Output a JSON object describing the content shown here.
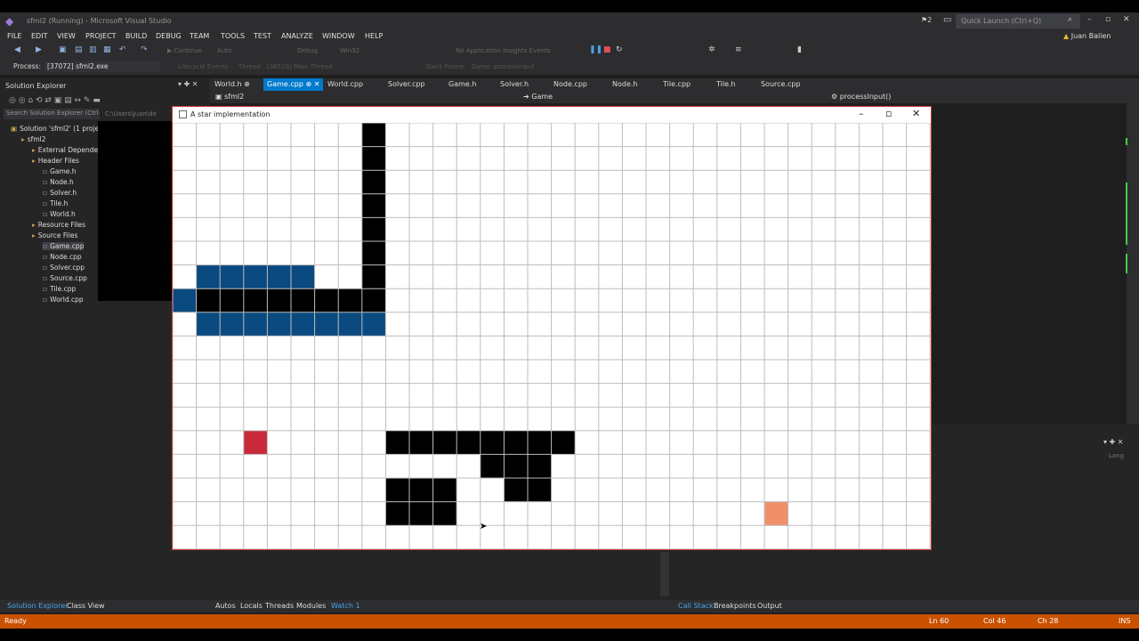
{
  "ide": {
    "title": "sfml2 (Running) - Microsoft Visual Studio",
    "notifications": "2",
    "quick_launch": "Quick Launch (Ctrl+Q)",
    "user": "Juan Balien",
    "menu": [
      "FILE",
      "EDIT",
      "VIEW",
      "PROJECT",
      "BUILD",
      "DEBUG",
      "TEAM",
      "TOOLS",
      "TEST",
      "ANALYZE",
      "WINDOW",
      "HELP"
    ],
    "toolbar": {
      "continue": "Continue",
      "auto": "Auto",
      "debug": "Debug",
      "platform": "Win32",
      "insights": "No Application Insights Events"
    },
    "debugbar": {
      "process_label": "Process:",
      "process_value": "[37072] sfml2.exe",
      "lifecycle": "Lifecycle Events",
      "thread_label": "Thread:",
      "thread_value": "[36520] Main Thread",
      "stack_label": "Stack Frame:",
      "stack_value": "Game::processInput"
    },
    "solution_explorer": {
      "title": "Solution Explorer",
      "search_placeholder": "Search Solution Explorer (Ctrl+;)",
      "path_hint": "C:\\Users\\Juan\\de",
      "tree": [
        {
          "label": "Solution 'sfml2' (1 proje",
          "indent": 0
        },
        {
          "label": "sfml2",
          "indent": 1
        },
        {
          "label": "External Dependencies",
          "indent": 2
        },
        {
          "label": "Header Files",
          "indent": 2
        },
        {
          "label": "Game.h",
          "indent": 3
        },
        {
          "label": "Node.h",
          "indent": 3
        },
        {
          "label": "Solver.h",
          "indent": 3
        },
        {
          "label": "Tile.h",
          "indent": 3
        },
        {
          "label": "World.h",
          "indent": 3
        },
        {
          "label": "Resource Files",
          "indent": 2
        },
        {
          "label": "Source Files",
          "indent": 2
        },
        {
          "label": "Game.cpp",
          "indent": 3
        },
        {
          "label": "Node.cpp",
          "indent": 3
        },
        {
          "label": "Solver.cpp",
          "indent": 3
        },
        {
          "label": "Source.cpp",
          "indent": 3
        },
        {
          "label": "Tile.cpp",
          "indent": 3
        },
        {
          "label": "World.cpp",
          "indent": 3
        }
      ]
    },
    "tabs": [
      "World.h",
      "Game.cpp",
      "World.cpp",
      "Solver.cpp",
      "Game.h",
      "Solver.h",
      "Node.cpp",
      "Node.h",
      "Tile.cpp",
      "Tile.h",
      "Source.cpp"
    ],
    "active_tab": "Game.cpp",
    "nav": {
      "project": "sfml2",
      "scope": "Game",
      "member": "processInput()"
    },
    "bottom_tabs_left": [
      "Solution Explorer",
      "Class View"
    ],
    "bottom_tabs_mid": [
      "Autos",
      "Locals",
      "Threads",
      "Modules",
      "Watch 1"
    ],
    "bottom_tabs_right": [
      "Call Stack",
      "Breakpoints",
      "Output"
    ],
    "bottom_panel_hint": "Lang",
    "status": {
      "ready": "Ready",
      "ln": "Ln 60",
      "col": "Col 46",
      "ch": "Ch 28",
      "ins": "INS"
    },
    "colors": {
      "accent": "#007acc",
      "statusbar": "#ca5100"
    }
  },
  "sfml_window": {
    "title": "A star implementation",
    "grid": {
      "cols": 32,
      "rows": 18,
      "wall_color": "#000000",
      "path_color": "#0a4a80",
      "start_color": "#c82a3a",
      "goal_color": "#f0906a",
      "walls": [
        [
          8,
          0
        ],
        [
          8,
          1
        ],
        [
          8,
          2
        ],
        [
          8,
          3
        ],
        [
          8,
          4
        ],
        [
          8,
          5
        ],
        [
          8,
          6
        ],
        [
          8,
          7
        ],
        [
          1,
          7
        ],
        [
          2,
          7
        ],
        [
          3,
          7
        ],
        [
          4,
          7
        ],
        [
          5,
          7
        ],
        [
          6,
          7
        ],
        [
          7,
          7
        ],
        [
          9,
          13
        ],
        [
          10,
          13
        ],
        [
          11,
          13
        ],
        [
          12,
          13
        ],
        [
          13,
          13
        ],
        [
          14,
          13
        ],
        [
          15,
          13
        ],
        [
          16,
          13
        ],
        [
          13,
          14
        ],
        [
          14,
          14
        ],
        [
          15,
          14
        ],
        [
          9,
          15
        ],
        [
          10,
          15
        ],
        [
          11,
          15
        ],
        [
          14,
          15
        ],
        [
          15,
          15
        ],
        [
          9,
          16
        ],
        [
          10,
          16
        ],
        [
          11,
          16
        ]
      ],
      "path": [
        [
          1,
          6
        ],
        [
          2,
          6
        ],
        [
          3,
          6
        ],
        [
          4,
          6
        ],
        [
          5,
          6
        ],
        [
          0,
          7
        ],
        [
          1,
          8
        ],
        [
          2,
          8
        ],
        [
          3,
          8
        ],
        [
          4,
          8
        ],
        [
          5,
          8
        ],
        [
          6,
          8
        ],
        [
          7,
          8
        ],
        [
          8,
          8
        ]
      ],
      "start": [
        3,
        13
      ],
      "goal": [
        25,
        16
      ]
    }
  }
}
